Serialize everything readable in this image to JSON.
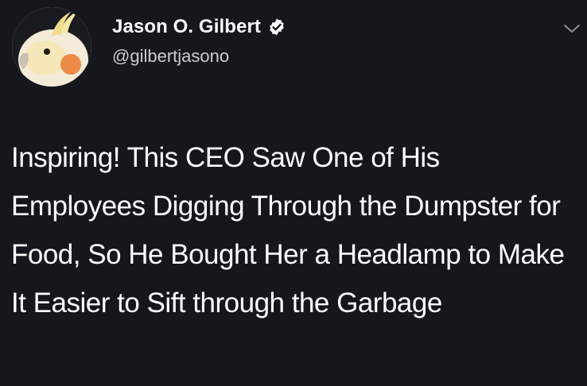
{
  "tweet": {
    "author": {
      "display_name": "Jason O. Gilbert",
      "handle": "@gilbertjasono",
      "verified": true,
      "avatar_icon": "cockatiel-avatar-icon"
    },
    "body_text": "Inspiring! This CEO Saw One of His Employees Digging Through the Dumpster for Food, So He Bought Her a Headlamp to Make It Easier to Sift through the Garbage",
    "menu_icon": "chevron-down-icon"
  },
  "colors": {
    "background": "#16171d",
    "text": "#ffffff",
    "handle": "#c9cdd4",
    "verified_badge": "#ffffff"
  }
}
